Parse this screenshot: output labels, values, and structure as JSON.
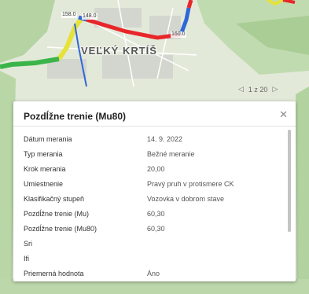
{
  "map": {
    "town_name": "VEĽKÝ KRTÍŠ",
    "road_tags": [
      "158.0",
      "148.0",
      "160.0"
    ]
  },
  "pager": {
    "text": "1 z 20",
    "prev": "◁",
    "next": "▷"
  },
  "popup": {
    "title": "Pozdĺžne trenie (Mu80)",
    "close": "✕",
    "rows": [
      {
        "label": "Dátum merania",
        "value": "14. 9. 2022"
      },
      {
        "label": "Typ merania",
        "value": "Bežné meranie"
      },
      {
        "label": "Krok merania",
        "value": "20,00"
      },
      {
        "label": "Umiestnenie",
        "value": "Pravý pruh v protismere CK"
      },
      {
        "label": "Klasifikačný stupeň",
        "value": "Vozovka v dobrom stave"
      },
      {
        "label": "Pozdĺžne trenie (Mu)",
        "value": "60,30"
      },
      {
        "label": "Pozdĺžne trenie (Mu80)",
        "value": "60,30"
      },
      {
        "label": "Sri",
        "value": ""
      },
      {
        "label": "Ifi",
        "value": ""
      },
      {
        "label": "Priemerná hodnota",
        "value": "Áno"
      }
    ]
  },
  "colors": {
    "road_red": "#e8262a",
    "road_blue": "#2f67d8",
    "road_green": "#3bb54a",
    "road_yellow": "#e6e23a"
  }
}
